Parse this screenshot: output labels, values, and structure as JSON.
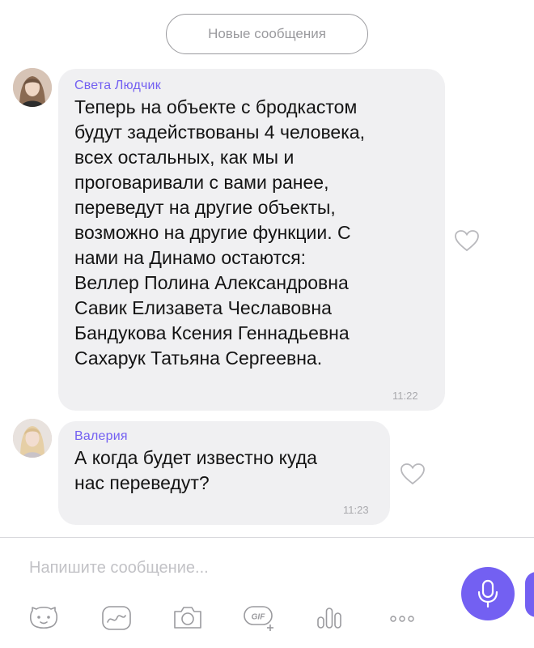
{
  "new_messages_label": "Новые сообщения",
  "messages": [
    {
      "sender": "Света Людчик",
      "text": "Теперь на объекте с бродкастом\nбудут задействованы 4 человека,\nвсех остальных, как мы и\nпроговаривали с вами ранее,\nпереведут на другие объекты,\nвозможно на другие функции. С\nнами на Динамо остаются:\nВеллер Полина Александровна\nСавик Елизавета Чеславовна\nБандукова Ксения Геннадьевна\nСахарук Татьяна Сергеевна.",
      "time": "11:22"
    },
    {
      "sender": "Валерия",
      "text": "А когда будет известно куда\nнас переведут?",
      "time": "11:23"
    }
  ],
  "composer": {
    "placeholder": "Напишите сообщение...",
    "value": ""
  },
  "toolbar": [
    "sticker-icon",
    "doodle-icon",
    "camera-icon",
    "gif-icon",
    "poll-icon",
    "more-icon"
  ],
  "colors": {
    "accent": "#7360f2",
    "bubble": "#f0f0f2",
    "meta_gray": "#a9a9ad"
  }
}
